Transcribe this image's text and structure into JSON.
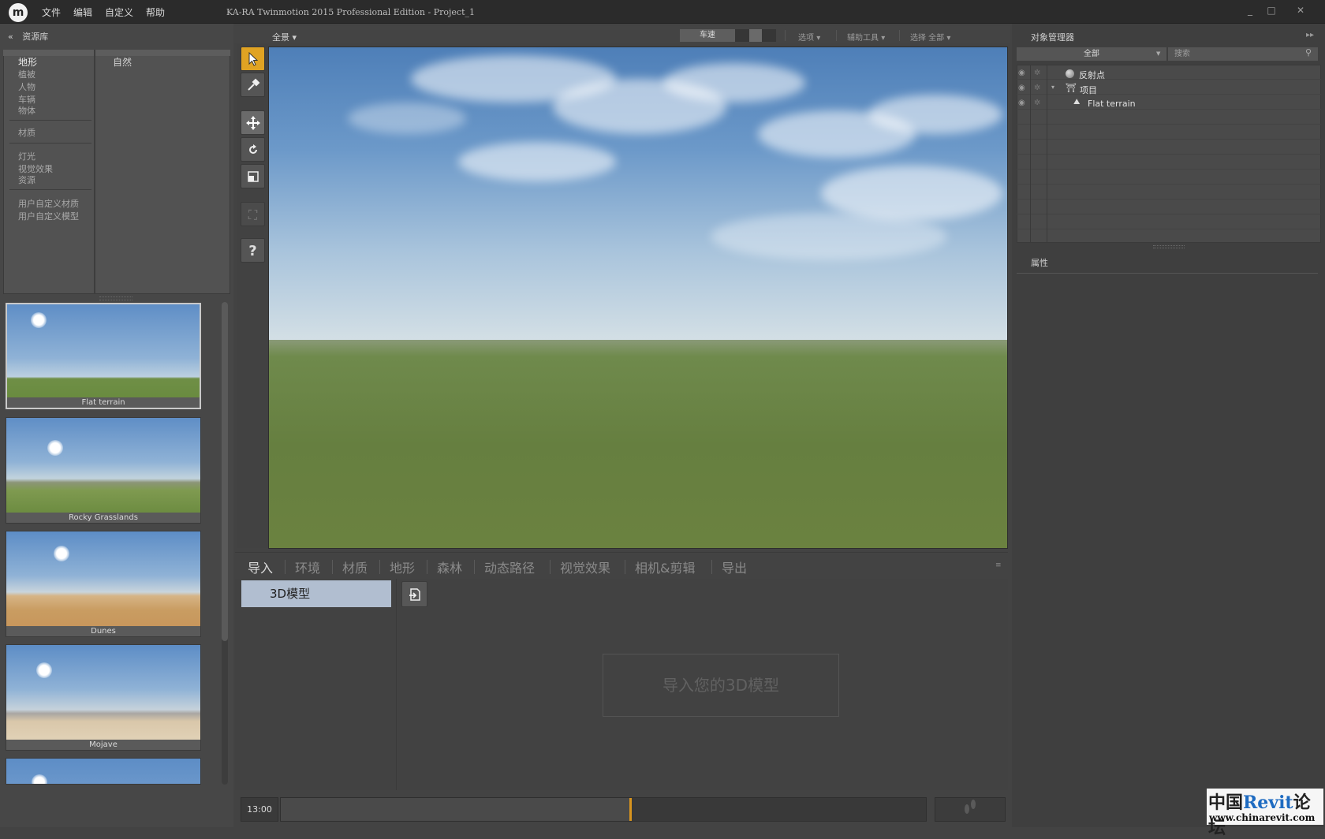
{
  "titlebar": {
    "logo_icon": "twinmotion-logo-icon",
    "menus": [
      "文件",
      "编辑",
      "自定义",
      "帮助"
    ],
    "title": "KA-RA Twinmotion 2015 Professional Edition - Project_1",
    "buttons": [
      "_",
      "□",
      "✕"
    ]
  },
  "library": {
    "header": "资源库",
    "collapse_icon": "«",
    "categories_group1": [
      "地形",
      "植被",
      "人物",
      "车辆",
      "物体"
    ],
    "categories_group2": [
      "材质"
    ],
    "categories_group3": [
      "灯光",
      "视觉效果",
      "资源"
    ],
    "categories_group4": [
      "用户自定义材质",
      "用户自定义模型"
    ],
    "subcategory": "自然",
    "thumbnails": [
      {
        "caption": "Flat terrain"
      },
      {
        "caption": "Rocky Grasslands"
      },
      {
        "caption": "Dunes"
      },
      {
        "caption": "Mojave"
      }
    ]
  },
  "toolbar": {
    "icons": [
      "select-arrow-icon",
      "eyedropper-icon",
      "move-icon",
      "rotate-icon",
      "scale-icon",
      "fit-view-icon",
      "help-icon"
    ],
    "help_label": "?"
  },
  "viewport_bar": {
    "view": "全景",
    "speed": "车速",
    "options": "选项",
    "helpers": "辅助工具",
    "select": "选择 全部",
    "dropdown_arrow": "▾"
  },
  "bottom_tabs": {
    "tabs": [
      "导入",
      "环境",
      "材质",
      "地形",
      "森林",
      "动态路径",
      "视觉效果",
      "相机&剪辑",
      "导出"
    ],
    "active": "导入",
    "collapse": "≡"
  },
  "import_panel": {
    "item": "3D模型",
    "import_icon": "import-file-icon",
    "placeholder": "导入您的3D模型"
  },
  "timeline": {
    "time": "13:00",
    "progress": 0.54
  },
  "object_manager": {
    "title": "对象管理器",
    "filter": "全部",
    "search_placeholder": "搜索",
    "items": [
      {
        "label": "反射点",
        "icon": "sphere-icon"
      },
      {
        "label": "项目",
        "icon": "project-icon"
      },
      {
        "label": "Flat terrain",
        "icon": "terrain-icon"
      }
    ]
  },
  "properties": {
    "title": "属性"
  },
  "watermark": {
    "brand_prefix": "中国",
    "brand_mid": "Revit",
    "brand_suffix": "论坛",
    "url": "www.chinarevit.com"
  }
}
